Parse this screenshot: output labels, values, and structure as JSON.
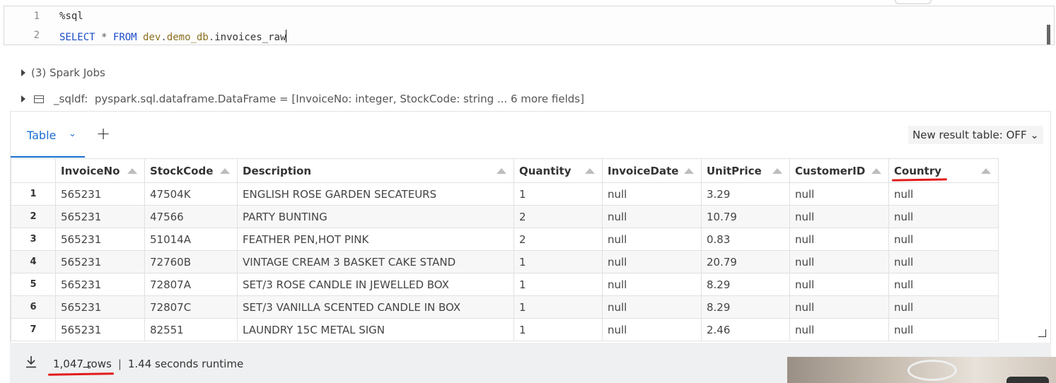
{
  "editor": {
    "lines": [
      {
        "num": "1",
        "text": "%sql"
      },
      {
        "num": "2",
        "keyword_select": "SELECT",
        "star": "*",
        "keyword_from": "FROM",
        "db1": "dev",
        "db2": "demo_db",
        "table": "invoices_raw"
      }
    ]
  },
  "output": {
    "spark_jobs": "(3) Spark Jobs",
    "df_name": "_sqldf:",
    "df_type": "pyspark.sql.dataframe.DataFrame = [InvoiceNo: integer, StockCode: string ... 6 more fields]"
  },
  "result": {
    "tab_label": "Table",
    "new_result_label": "New result table: OFF",
    "columns": [
      "InvoiceNo",
      "StockCode",
      "Description",
      "Quantity",
      "InvoiceDate",
      "UnitPrice",
      "CustomerID",
      "Country"
    ],
    "rows": [
      {
        "n": "1",
        "cells": [
          "565231",
          "47504K",
          "ENGLISH ROSE GARDEN SECATEURS",
          "1",
          "null",
          "3.29",
          "null",
          "null"
        ]
      },
      {
        "n": "2",
        "cells": [
          "565231",
          "47566",
          "PARTY BUNTING",
          "2",
          "null",
          "10.79",
          "null",
          "null"
        ]
      },
      {
        "n": "3",
        "cells": [
          "565231",
          "51014A",
          "FEATHER PEN,HOT PINK",
          "2",
          "null",
          "0.83",
          "null",
          "null"
        ]
      },
      {
        "n": "4",
        "cells": [
          "565231",
          "72760B",
          "VINTAGE CREAM 3 BASKET CAKE STAND",
          "1",
          "null",
          "20.79",
          "null",
          "null"
        ]
      },
      {
        "n": "5",
        "cells": [
          "565231",
          "72807A",
          "SET/3 ROSE CANDLE IN JEWELLED BOX",
          "1",
          "null",
          "8.29",
          "null",
          "null"
        ]
      },
      {
        "n": "6",
        "cells": [
          "565231",
          "72807C",
          "SET/3 VANILLA SCENTED CANDLE IN BOX",
          "1",
          "null",
          "8.29",
          "null",
          "null"
        ]
      },
      {
        "n": "7",
        "cells": [
          "565231",
          "82551",
          "LAUNDRY 15C METAL SIGN",
          "1",
          "null",
          "2.46",
          "null",
          "null"
        ]
      }
    ],
    "row_count": "1,047 rows",
    "separator": "|",
    "runtime": "1.44 seconds runtime"
  },
  "colors": {
    "accent": "#1a6fd3",
    "annotation": "#e21c1c"
  }
}
